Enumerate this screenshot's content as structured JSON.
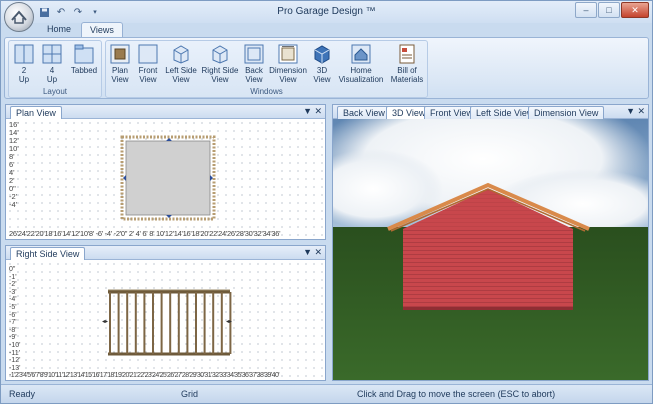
{
  "window": {
    "title": "Pro Garage Design ™"
  },
  "ribbon": {
    "tabs": [
      "Home",
      "Views"
    ],
    "layout_group": {
      "title": "Layout",
      "buttons": [
        "2\nUp",
        "4\nUp",
        "Tabbed"
      ]
    },
    "windows_group": {
      "title": "Windows",
      "buttons": [
        "Plan\nView",
        "Front\nView",
        "Left Side\nView",
        "Right Side\nView",
        "Back\nView",
        "Dimension\nView",
        "3D\nView",
        "Home\nVisualization",
        "Bill of\nMaterials"
      ]
    }
  },
  "plan_panel": {
    "tab": "Plan View",
    "y_ruler": [
      "16'",
      "14'",
      "12'",
      "10'",
      "8'",
      "6'",
      "4'",
      "2'",
      "0\"",
      "-2'",
      "-4'"
    ],
    "x_ruler": "26'24'22'20'18'16'14'12'10'8' -6' -4' -2'0\" 2' 4' 6' 8' 10'12'14'16'18'20'22'24'26'28'30'32'34'36'"
  },
  "side_panel": {
    "tab": "Right Side View",
    "y_ruler": [
      "0\"",
      "-1'",
      "-2'",
      "-3'",
      "-4'",
      "-5'",
      "-6'",
      "-7'",
      "-8'",
      "-9'",
      "-10'",
      "-11'",
      "-12'",
      "-13'"
    ],
    "x_ruler": "-1'2'3'4'5'6'7'8'9'10'11'12'13'14'15'16'17'18'19'20'21'22'23'24'25'26'27'28'29'30'31'32'33'34'35'36'37'38'39'40'"
  },
  "view3d_panel": {
    "tabs": [
      "Back View",
      "3D View",
      "Front View",
      "Left Side View",
      "Dimension View"
    ],
    "active_tab": "3D View"
  },
  "status": {
    "left": "Ready",
    "mid": "Grid",
    "right": "Click and Drag to move the screen  (ESC to abort)"
  },
  "colors": {
    "siding": "#c8474c",
    "roof_trim": "#d98a4b",
    "lawn": "#2f5a22",
    "sky": "#6f93b8"
  }
}
